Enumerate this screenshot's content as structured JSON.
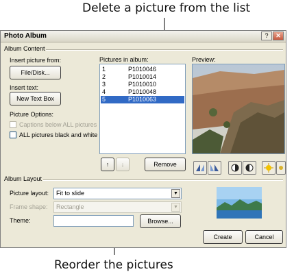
{
  "callouts": {
    "top": "Delete a picture from the list",
    "bottom": "Reorder the pictures"
  },
  "dialog": {
    "title": "Photo Album",
    "help_glyph": "?",
    "close_glyph": "✕",
    "album_content": {
      "group_label": "Album Content",
      "insert_picture_label": "Insert picture from:",
      "file_disk_button": "File/Disk...",
      "insert_text_label": "Insert text:",
      "new_text_box_button": "New Text Box",
      "picture_options_label": "Picture Options:",
      "captions_option": {
        "label": "Captions below ALL pictures",
        "checked": false,
        "disabled": true
      },
      "black_white_option": {
        "label": "ALL pictures black and white",
        "checked": false,
        "disabled": false
      },
      "pictures_label": "Pictures in album:",
      "pictures": [
        {
          "num": "1",
          "name": "P1010046"
        },
        {
          "num": "2",
          "name": "P1010014"
        },
        {
          "num": "3",
          "name": "P1010010"
        },
        {
          "num": "4",
          "name": "P1010048"
        },
        {
          "num": "5",
          "name": "P1010063",
          "selected": true
        }
      ],
      "move_up_glyph": "↑",
      "move_down_glyph": "↓",
      "remove_button": "Remove",
      "preview_label": "Preview:",
      "preview_tools": [
        "rotate-left-icon",
        "rotate-right-icon",
        "contrast-up-icon",
        "contrast-down-icon",
        "brightness-up-icon",
        "brightness-down-icon"
      ]
    },
    "album_layout": {
      "group_label": "Album Layout",
      "picture_layout_label": "Picture layout:",
      "picture_layout_value": "Fit to slide",
      "frame_shape_label": "Frame shape:",
      "frame_shape_value": "Rectangle",
      "theme_label": "Theme:",
      "theme_value": "",
      "browse_button": "Browse...",
      "create_button": "Create",
      "cancel_button": "Cancel"
    }
  },
  "colors": {
    "dialog_bg": "#ece9d8",
    "selection": "#316ac5",
    "list_border": "#7f9db9"
  }
}
